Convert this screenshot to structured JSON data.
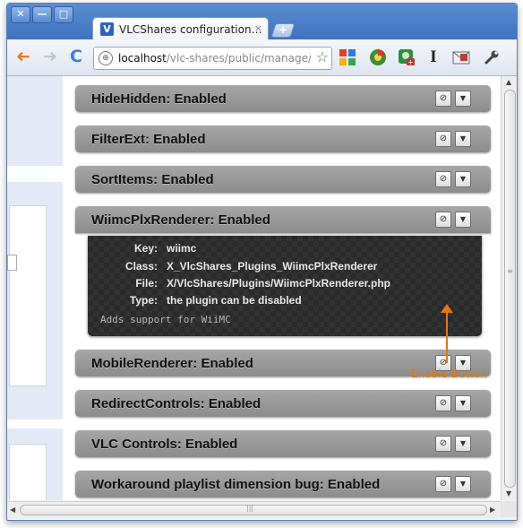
{
  "window": {
    "controls": [
      "✕",
      "—",
      "□"
    ]
  },
  "tab": {
    "favicon": "V",
    "title": "VLCShares configuration…",
    "close": "×"
  },
  "new_tab": "+",
  "toolbar": {
    "back_icon": "➜",
    "forward_icon": "➜",
    "reload_icon": "C",
    "url_host": "localhost",
    "url_path": "/vlc-shares/public/manage/conf",
    "bookmark_icon": "☆",
    "wrench_icon": "wrench-icon"
  },
  "extensions": [
    {
      "name": "tiles-extension",
      "color": "#f2b01e"
    },
    {
      "name": "chrome-web-extension",
      "color": "#3b8d3a"
    },
    {
      "name": "badge-extension",
      "color": "#2d8c3f"
    },
    {
      "name": "text-extension",
      "label": "I"
    },
    {
      "name": "mail-extension",
      "color": "#c0392b"
    }
  ],
  "plugins": [
    {
      "title": "HideHidden: Enabled"
    },
    {
      "title": "FilterExt: Enabled"
    },
    {
      "title": "SortItems: Enabled"
    },
    {
      "title": "WiimcPlxRenderer: Enabled"
    },
    {
      "title": "MobileRenderer: Enabled"
    },
    {
      "title": "RedirectControls: Enabled"
    },
    {
      "title": "VLC Controls: Enabled"
    },
    {
      "title": "Workaround playlist dimension bug: Enabled"
    }
  ],
  "plugin_buttons": {
    "toggle_symbol": "⊘",
    "menu_symbol": "▼"
  },
  "details": {
    "rows": [
      {
        "label": "Key:",
        "value": "wiimc"
      },
      {
        "label": "Class:",
        "value": "X_VlcShares_Plugins_WiimcPlxRenderer"
      },
      {
        "label": "File:",
        "value": "X/VlcShares/Plugins/WiimcPlxRenderer.php"
      },
      {
        "label": "Type:",
        "value": "the plugin can be disabled"
      }
    ],
    "description": "Adds support for WiiMC"
  },
  "annotation": {
    "text": "Enable Button",
    "color": "#e8740c"
  },
  "scrollbars": {
    "up": "▲",
    "down": "▼",
    "left": "◀",
    "right": "▶",
    "grip": "≡",
    "hgrip": "|||"
  }
}
